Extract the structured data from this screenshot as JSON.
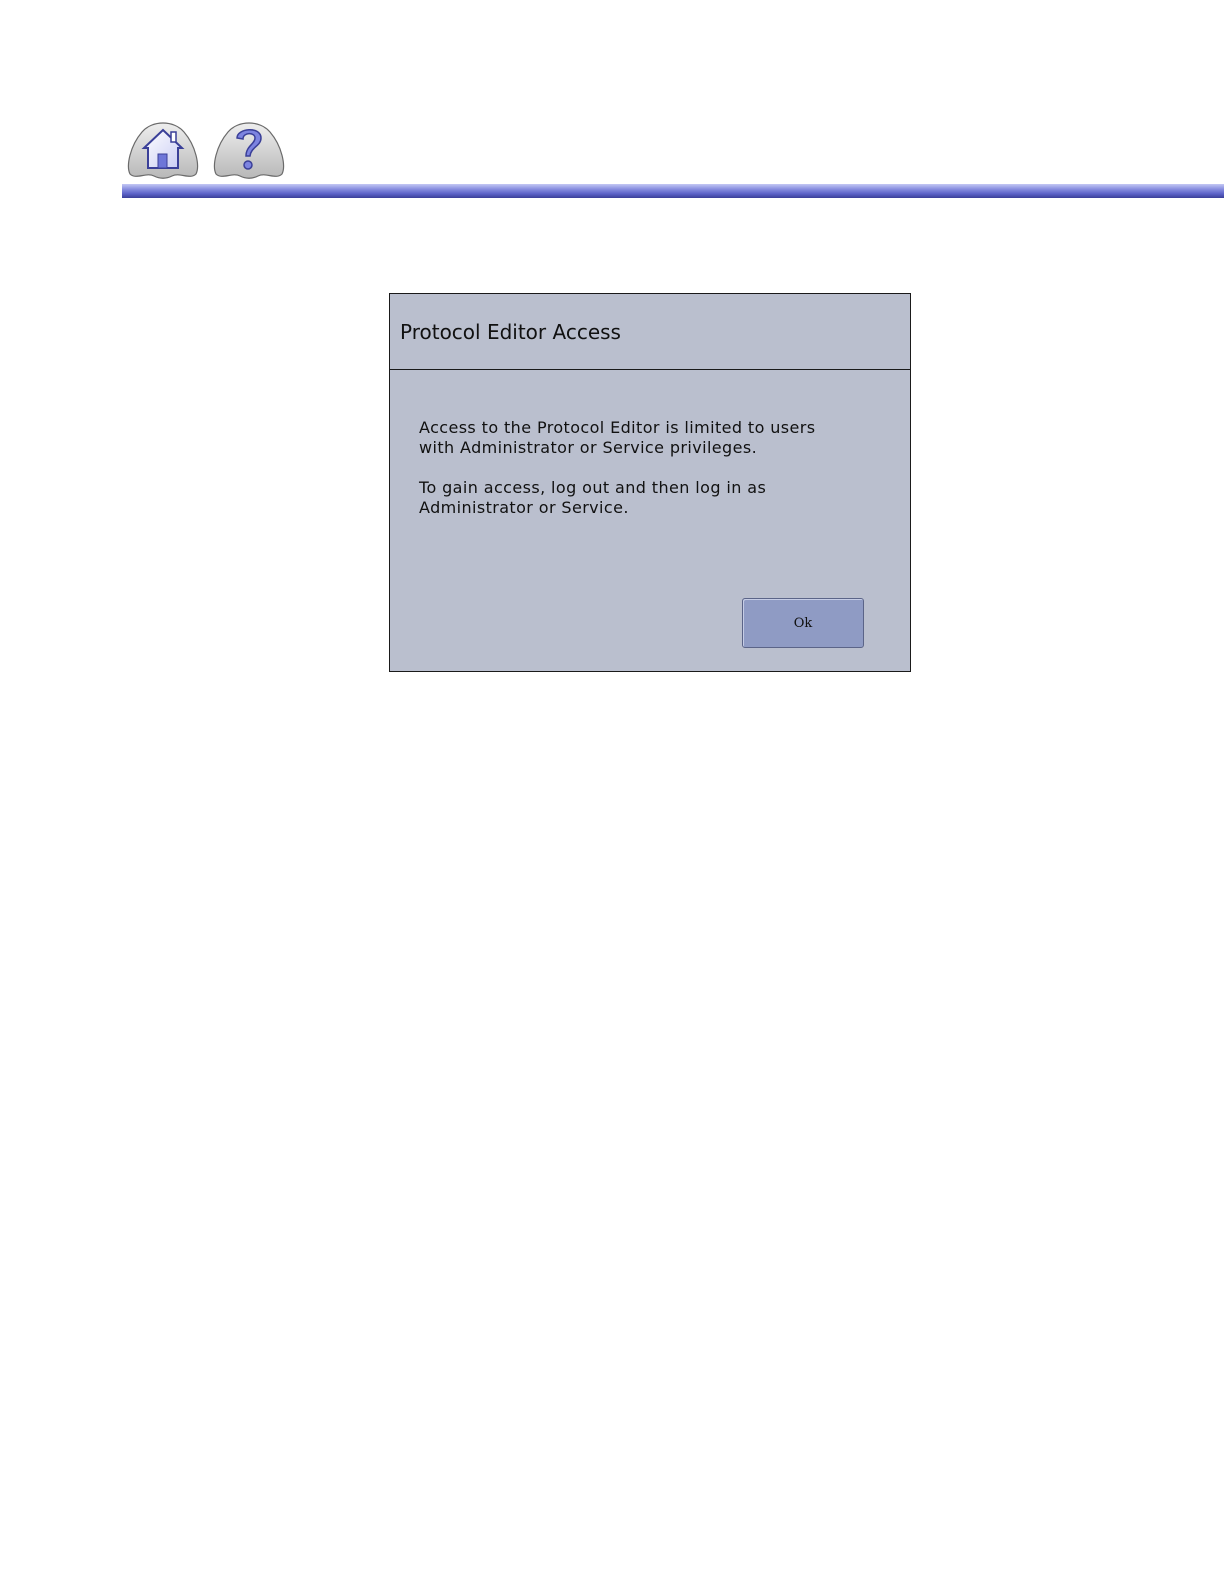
{
  "nav": {
    "home_icon": "home-icon",
    "help_icon": "question-mark-icon"
  },
  "colors": {
    "header_bar": "#5b62c8",
    "dialog_bg": "#babfce",
    "button_bg": "#8f9bc4",
    "icon_accent": "#7d84e0"
  },
  "dialog": {
    "title": "Protocol Editor Access",
    "message_paragraph_1": "Access to the Protocol Editor is limited to users\nwith Administrator or Service privileges.",
    "message_paragraph_2": "To gain access, log out and then log in as\nAdministrator or Service.",
    "ok_label": "Ok"
  }
}
